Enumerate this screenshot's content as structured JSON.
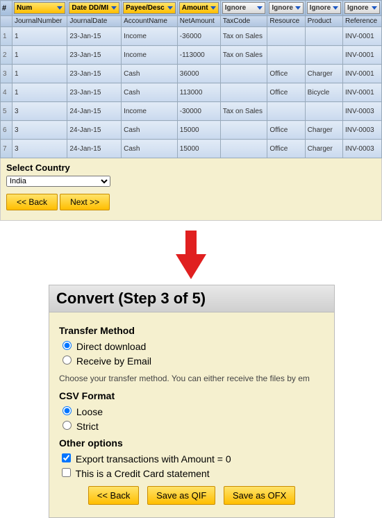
{
  "columns": {
    "maps": [
      "Num",
      "Date DD/MI",
      "Payee/Desc",
      "Amount",
      "Ignore",
      "Ignore",
      "Ignore",
      "Ignore"
    ],
    "mapStyle": [
      "amber",
      "amber",
      "amber",
      "amber",
      "grey",
      "grey",
      "grey",
      "grey"
    ],
    "names": [
      "JournalNumber",
      "JournalDate",
      "AccountName",
      "NetAmount",
      "TaxCode",
      "Resource",
      "Product",
      "Reference"
    ]
  },
  "rows": [
    {
      "n": "1",
      "c": [
        "1",
        "23-Jan-15",
        "Income",
        "-36000",
        "Tax on Sales",
        "",
        "",
        "INV-0001"
      ]
    },
    {
      "n": "2",
      "c": [
        "1",
        "23-Jan-15",
        "Income",
        "-113000",
        "Tax on Sales",
        "",
        "",
        "INV-0001"
      ]
    },
    {
      "n": "3",
      "c": [
        "1",
        "23-Jan-15",
        "Cash",
        "36000",
        "",
        "Office",
        "Charger",
        "INV-0001"
      ]
    },
    {
      "n": "4",
      "c": [
        "1",
        "23-Jan-15",
        "Cash",
        "113000",
        "",
        "Office",
        "Bicycle",
        "INV-0001"
      ]
    },
    {
      "n": "5",
      "c": [
        "3",
        "24-Jan-15",
        "Income",
        "-30000",
        "Tax on Sales",
        "",
        "",
        "INV-0003"
      ]
    },
    {
      "n": "6",
      "c": [
        "3",
        "24-Jan-15",
        "Cash",
        "15000",
        "",
        "Office",
        "Charger",
        "INV-0003"
      ]
    },
    {
      "n": "7",
      "c": [
        "3",
        "24-Jan-15",
        "Cash",
        "15000",
        "",
        "Office",
        "Charger",
        "INV-0003"
      ]
    }
  ],
  "country": {
    "label": "Select Country",
    "selected": "India"
  },
  "nav1": {
    "back": "<< Back",
    "next": "Next >>"
  },
  "step3": {
    "title": "Convert (Step 3 of 5)",
    "tm_label": "Transfer Method",
    "tm_direct": "Direct download",
    "tm_email": "Receive by Email",
    "tm_hint": "Choose your transfer method. You can either receive the files by em",
    "csv_label": "CSV Format",
    "csv_loose": "Loose",
    "csv_strict": "Strict",
    "other_label": "Other options",
    "opt_zero": "Export transactions with Amount = 0",
    "opt_cc": "This is a Credit Card statement",
    "back": "<< Back",
    "qif": "Save as QIF",
    "ofx": "Save as OFX"
  }
}
